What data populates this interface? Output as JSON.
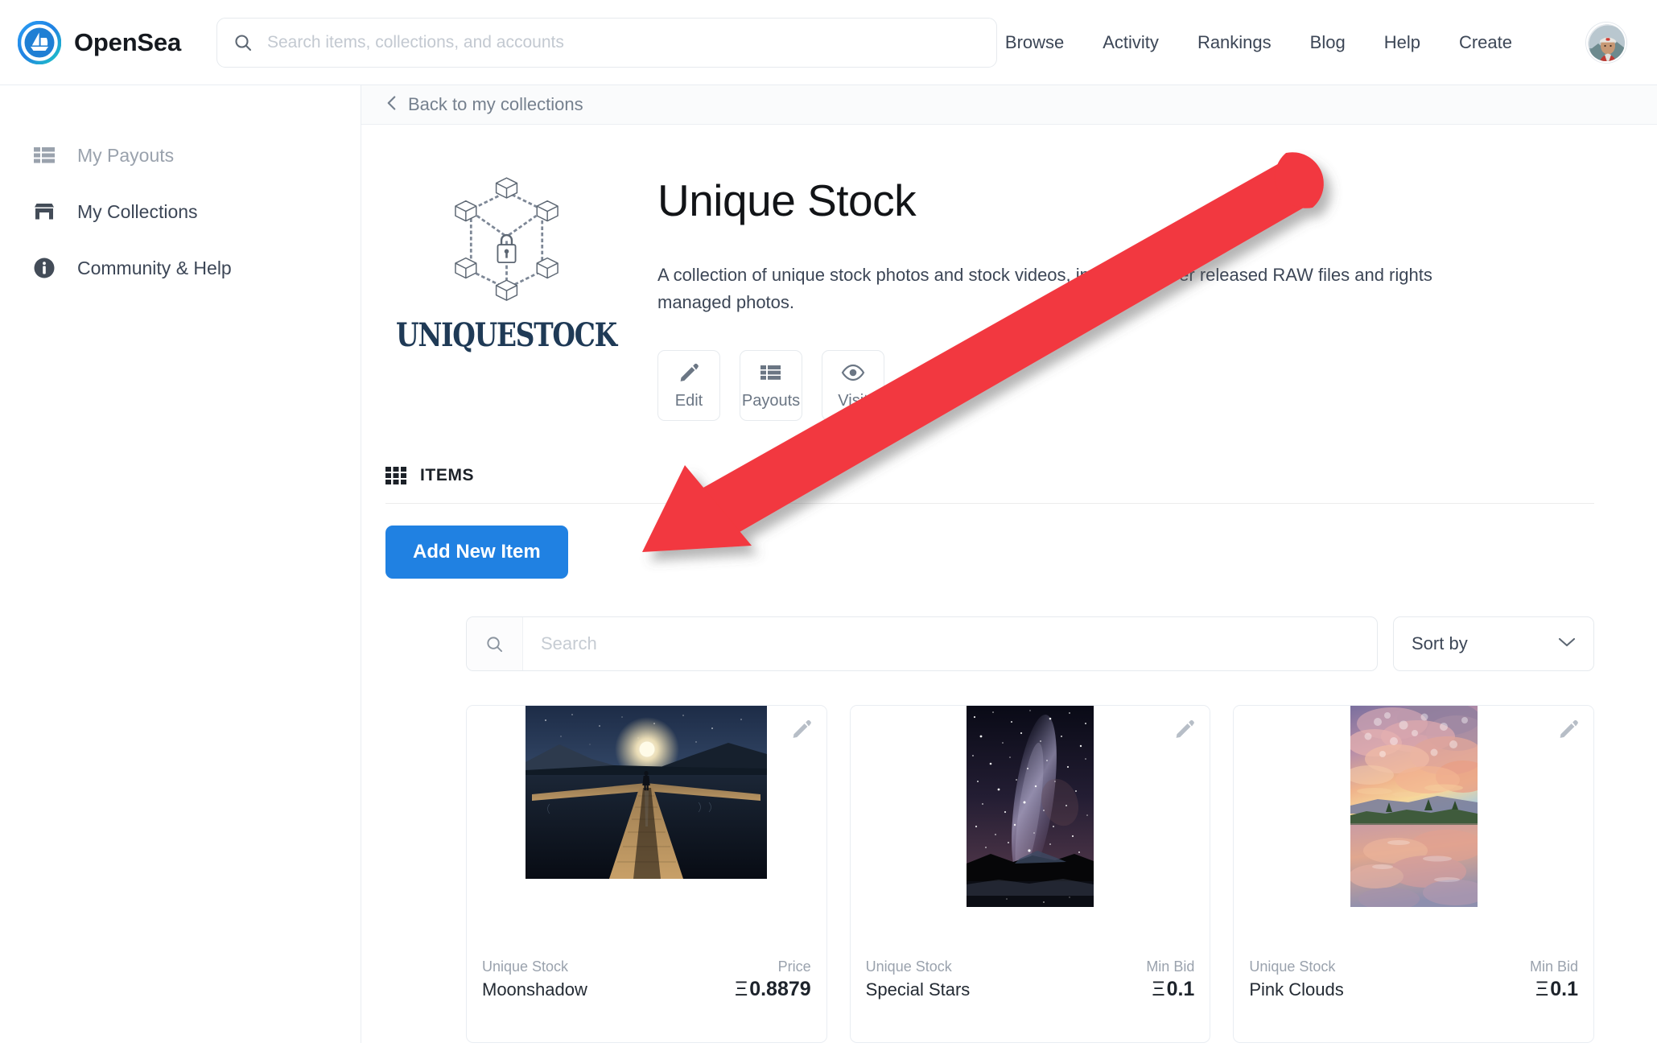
{
  "header": {
    "brand_name": "OpenSea",
    "brand_logo_icon": "opensea-sailboat-logo",
    "search_placeholder": "Search items, collections, and accounts",
    "search_value": "",
    "search_icon": "search-icon",
    "nav": [
      {
        "label": "Browse"
      },
      {
        "label": "Activity"
      },
      {
        "label": "Rankings"
      },
      {
        "label": "Blog"
      },
      {
        "label": "Help"
      },
      {
        "label": "Create"
      }
    ],
    "avatar_icon": "user-avatar-photo"
  },
  "sidebar": {
    "items": [
      {
        "label": "My Payouts",
        "icon": "list-table-icon",
        "muted": true
      },
      {
        "label": "My Collections",
        "icon": "storefront-icon",
        "muted": false
      },
      {
        "label": "Community & Help",
        "icon": "info-circle-icon",
        "muted": false
      }
    ]
  },
  "breadcrumb": {
    "back_label": "Back to my collections",
    "back_icon": "chevron-left-icon"
  },
  "collection": {
    "title": "Unique Stock",
    "logo_icon": "blockchain-hexagon-lock-logo",
    "wordmark": "UNIQUESTOCK",
    "description": "A collection of unique stock photos and stock videos, including never released RAW files and rights managed photos.",
    "actions": [
      {
        "label": "Edit",
        "icon": "pencil-icon"
      },
      {
        "label": "Payouts",
        "icon": "list-table-icon"
      },
      {
        "label": "Visit",
        "icon": "eye-icon"
      }
    ]
  },
  "items_section": {
    "heading": "ITEMS",
    "heading_icon": "grid-icon",
    "add_button_label": "Add New Item",
    "search_placeholder": "Search",
    "search_value": "",
    "search_icon": "search-icon",
    "sort_label": "Sort by",
    "sort_icon": "chevron-down-icon",
    "cards": [
      {
        "collection": "Unique Stock",
        "name": "Moonshadow",
        "price_label": "Price",
        "price_value": "0.8879",
        "currency_symbol": "Ξ",
        "edit_icon": "pencil-icon",
        "image_alt": "moonlit-lake-dock"
      },
      {
        "collection": "Unique Stock",
        "name": "Special Stars",
        "price_label": "Min Bid",
        "price_value": "0.1",
        "currency_symbol": "Ξ",
        "edit_icon": "pencil-icon",
        "image_alt": "milky-way-starfield"
      },
      {
        "collection": "Unique Stock",
        "name": "Pink Clouds",
        "price_label": "Min Bid",
        "price_value": "0.1",
        "currency_symbol": "Ξ",
        "edit_icon": "pencil-icon",
        "image_alt": "pink-sunset-clouds-reflection"
      }
    ]
  },
  "annotation": {
    "arrow_icon": "red-pointer-arrow",
    "arrow_color": "#f2393f"
  },
  "colors": {
    "accent_blue": "#2081e2",
    "text_primary": "#232a33",
    "text_muted": "#9aa2ad",
    "border": "#e6eaee",
    "annotation_red": "#f2393f"
  }
}
